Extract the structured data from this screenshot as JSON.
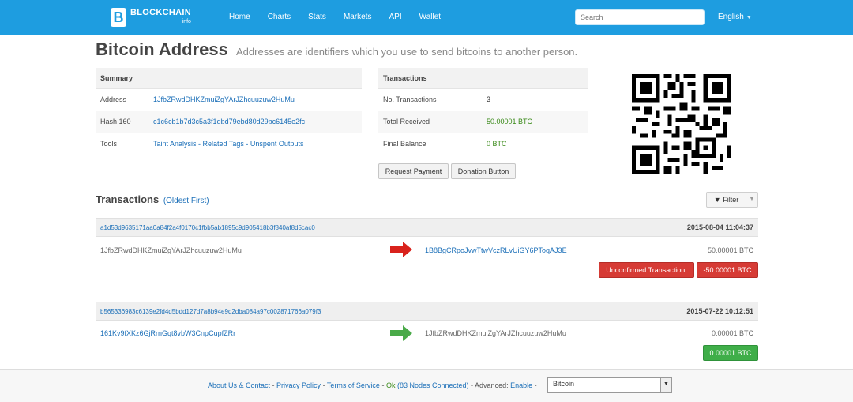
{
  "navbar": {
    "brand": "BLOCKCHAIN",
    "brand_sub": "info",
    "links": [
      "Home",
      "Charts",
      "Stats",
      "Markets",
      "API",
      "Wallet"
    ],
    "search_placeholder": "Search",
    "language": "English"
  },
  "header": {
    "title": "Bitcoin Address",
    "subtitle": "Addresses are identifiers which you use to send bitcoins to another person."
  },
  "summary": {
    "heading": "Summary",
    "address_label": "Address",
    "address": "1JfbZRwdDHKZmuiZgYArJZhcuuzuw2HuMu",
    "hash160_label": "Hash 160",
    "hash160": "c1c6cb1b7d3c5a3f1dbd79ebd80d29bc6145e2fc",
    "tools_label": "Tools",
    "tools": {
      "taint": "Taint Analysis",
      "sep1": " - ",
      "tags": "Related Tags",
      "sep2": " - ",
      "unspent": "Unspent Outputs"
    }
  },
  "transactions_box": {
    "heading": "Transactions",
    "no_tx_label": "No. Transactions",
    "no_tx": "3",
    "received_label": "Total Received",
    "received": "50.00001 BTC",
    "balance_label": "Final Balance",
    "balance": "0 BTC"
  },
  "buttons": {
    "request_payment": "Request Payment",
    "donation": "Donation Button"
  },
  "tx_list": {
    "heading": "Transactions",
    "order_link": "(Oldest First)",
    "filter_label": "Filter",
    "items": [
      {
        "hash": "a1d53d9635171aa0a84f2a4f0170c1fbb5ab1895c9d905418b3f840af8d5cac0",
        "time": "2015-08-04 11:04:37",
        "from": "1JfbZRwdDHKZmuiZgYArJZhcuuzuw2HuMu",
        "to": "1B8BgCRpoJvwTtwVczRLvUiGY6PToqAJ3E",
        "amount": "50.00001 BTC",
        "status": "Unconfirmed Transaction!",
        "net": "-50.00001 BTC",
        "arrow_color": "#d9221c"
      },
      {
        "hash": "b565336983c6139e2fd4d5bdd127d7a8b94e9d2dba084a97c002871766a079f3",
        "time": "2015-07-22 10:12:51",
        "from": "161Kv9fXKz6GjRrnGqt8vbW3CnpCupfZRr",
        "to": "1JfbZRwdDHKZmuiZgYArJZhcuuzuw2HuMu",
        "amount": "0.00001 BTC",
        "net": "0.00001 BTC",
        "arrow_color": "#4aaa49"
      }
    ]
  },
  "footer": {
    "about": "About Us & Contact",
    "privacy": "Privacy Policy",
    "terms": "Terms of Service",
    "sep": " - ",
    "ok": "Ok",
    "nodes": "(83 Nodes Connected)",
    "advanced": "Advanced:",
    "enable": "Enable",
    "currency": "Bitcoin"
  }
}
